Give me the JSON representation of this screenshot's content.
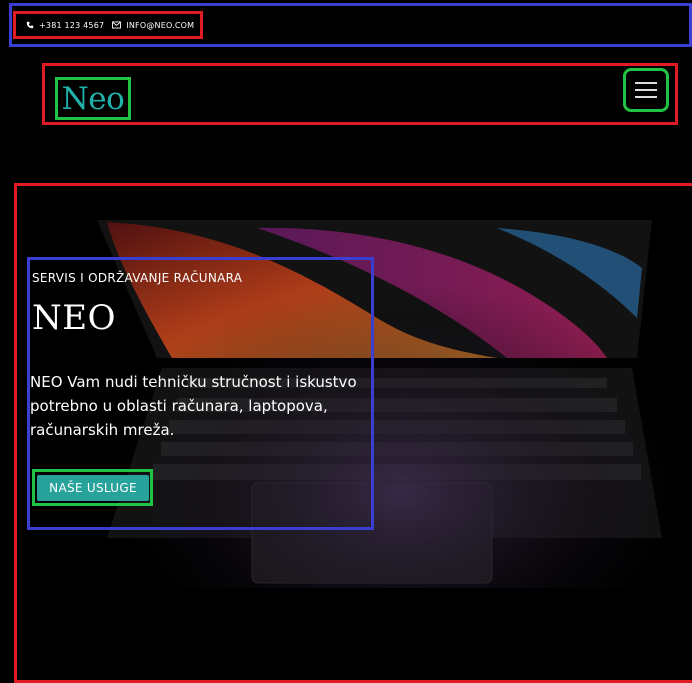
{
  "topbar": {
    "phone": "+381 123 4567",
    "email": "INFO@NEO.COM"
  },
  "header": {
    "logo": "Neo",
    "menu_icon": "hamburger-menu-icon"
  },
  "hero": {
    "subtitle": "SERVIS I ODRŽAVANJE RAČUNARA",
    "title": "NEO",
    "description": "NEO Vam nudi tehničku stručnost i iskustvo potrebno u oblasti računara, laptopova, računarskih mreža.",
    "cta_label": "NAŠE USLUGE"
  },
  "colors": {
    "background": "#000000",
    "accent": "#20b2aa",
    "button": "#27a39b",
    "annotation_red": "#e01b24",
    "annotation_blue": "#3b3fd1",
    "annotation_green": "#22c244"
  }
}
